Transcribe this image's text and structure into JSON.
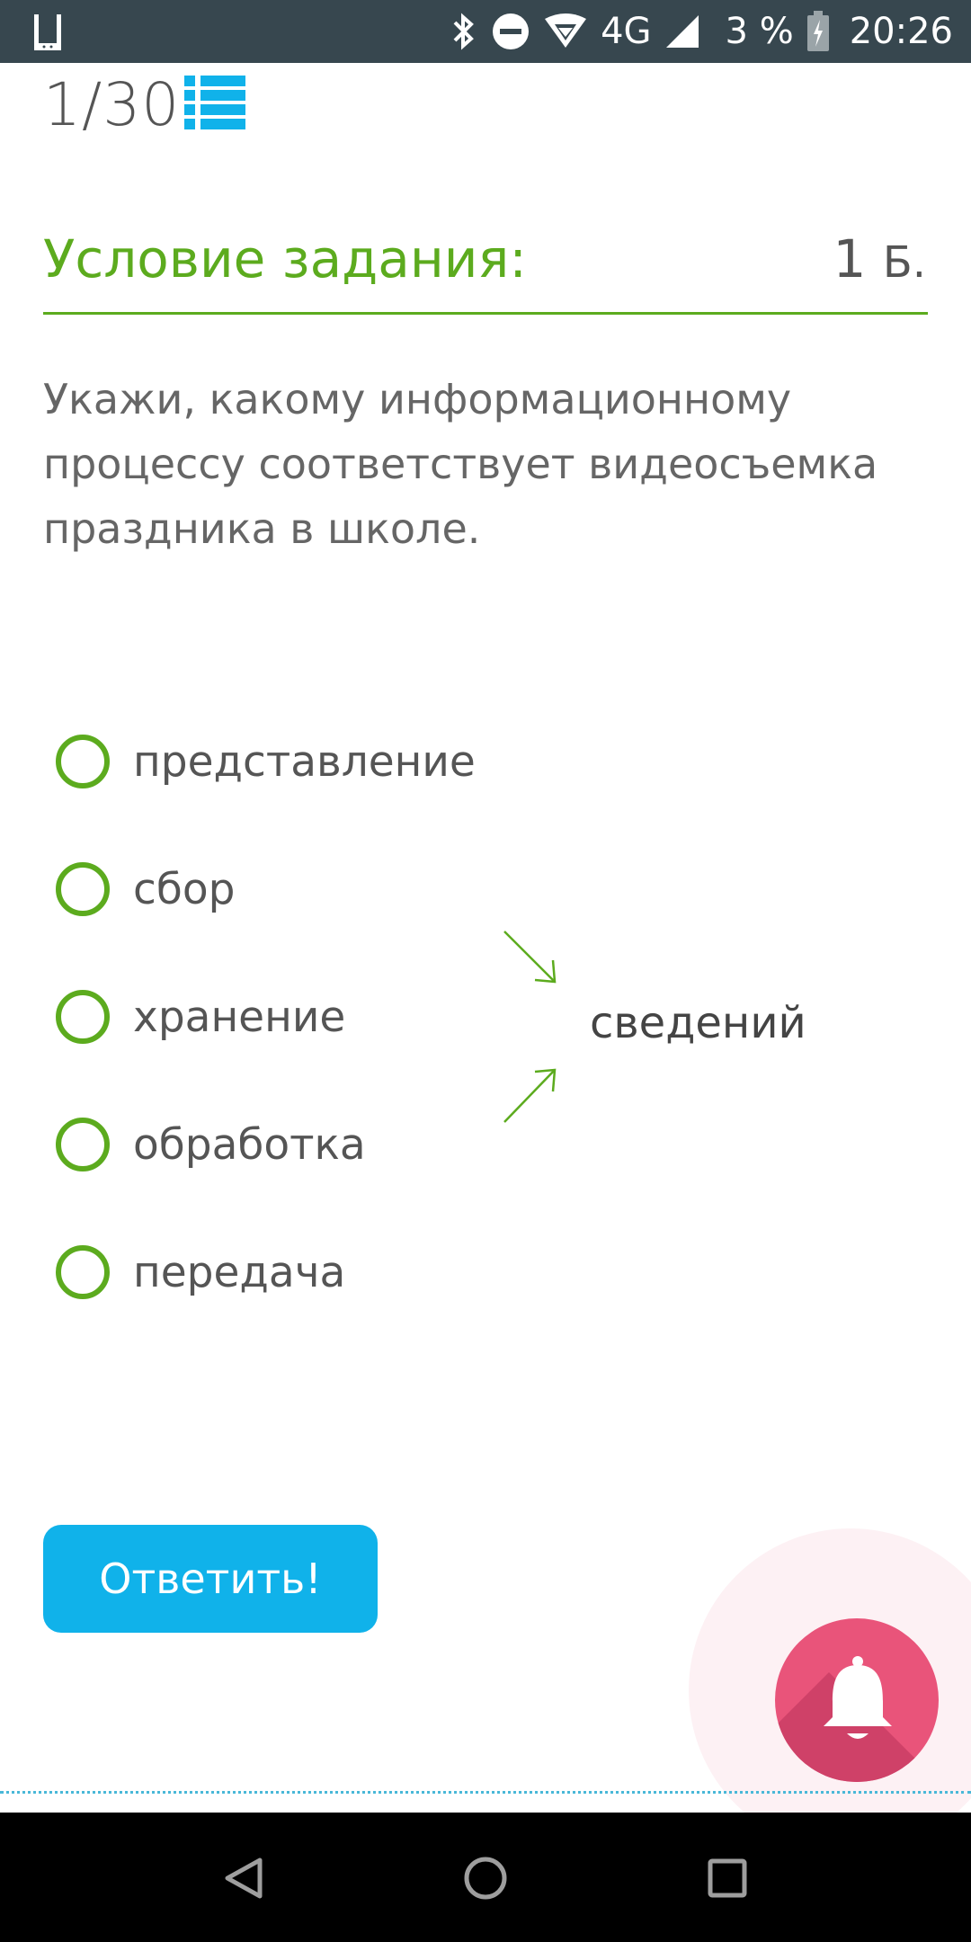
{
  "status_bar": {
    "battery_text": "3 %",
    "time": "20:26",
    "network": "4G",
    "icons": [
      "app-notification-icon",
      "bluetooth-icon",
      "do-not-disturb-icon",
      "wifi-icon",
      "signal-icon",
      "battery-charging-icon"
    ]
  },
  "header": {
    "counter": "1/30",
    "list_icon": "list-icon"
  },
  "task": {
    "title": "Условие задания:",
    "score_number": "1",
    "score_unit": "Б.",
    "question": "Укажи, какому информационному процессу соответствует видеосъемка праздника в школе."
  },
  "options": [
    {
      "label": "представление"
    },
    {
      "label": "сбор"
    },
    {
      "label": "хранение"
    },
    {
      "label": "обработка"
    },
    {
      "label": "передача"
    }
  ],
  "diagram": {
    "target_word": "сведений"
  },
  "answer_button": {
    "label": "Ответить!"
  },
  "fab": {
    "icon": "bell-icon"
  },
  "nav_bar": {
    "icons": [
      "back-icon",
      "home-icon",
      "recents-icon"
    ]
  },
  "colors": {
    "accent_green": "#5cab1e",
    "button_blue": "#10b2ea",
    "fab_pink": "#e9547a",
    "status_bar": "#37474f"
  }
}
